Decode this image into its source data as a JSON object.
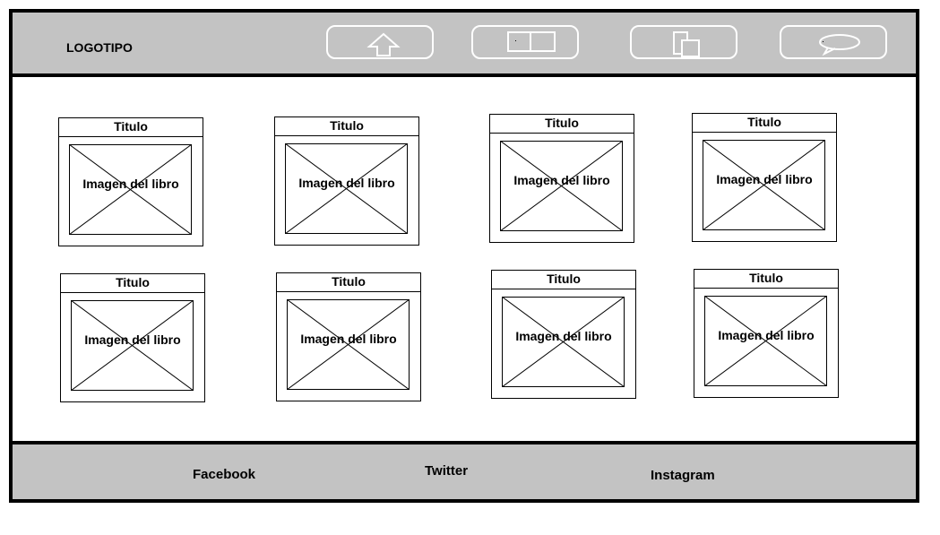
{
  "header": {
    "logo": "LOGOTIPO",
    "nav": [
      {
        "name": "home-button",
        "icon": "up-arrow-icon"
      },
      {
        "name": "layout-button",
        "icon": "split-window-icon"
      },
      {
        "name": "pages-button",
        "icon": "overlapping-pages-icon"
      },
      {
        "name": "chat-button",
        "icon": "speech-bubble-icon"
      }
    ]
  },
  "cards": [
    {
      "title": "Titulo",
      "image_label": "Imagen del libro"
    },
    {
      "title": "Titulo",
      "image_label": "Imagen del libro"
    },
    {
      "title": "Titulo",
      "image_label": "Imagen del libro"
    },
    {
      "title": "Titulo",
      "image_label": "Imagen del libro"
    },
    {
      "title": "Titulo",
      "image_label": "Imagen del libro"
    },
    {
      "title": "Titulo",
      "image_label": "Imagen del libro"
    },
    {
      "title": "Titulo",
      "image_label": "Imagen del libro"
    },
    {
      "title": "Titulo",
      "image_label": "Imagen del libro"
    }
  ],
  "footer": {
    "facebook": "Facebook",
    "twitter": "Twitter",
    "instagram": "Instagram"
  }
}
